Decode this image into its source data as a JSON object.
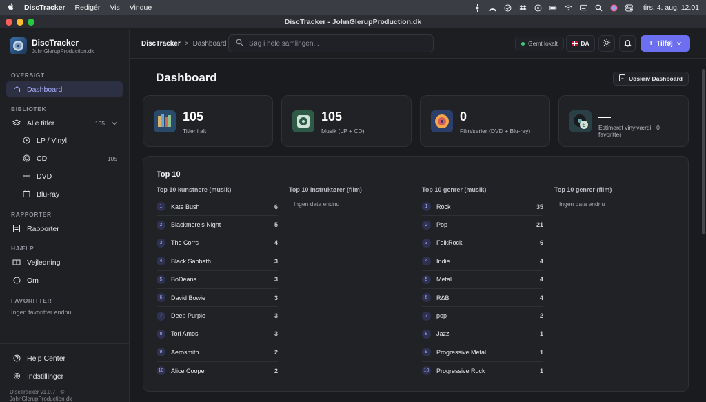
{
  "menubar": {
    "app": "DiscTracker",
    "items": [
      "Redigér",
      "Vis",
      "Vindue"
    ],
    "clock": "tirs. 4. aug.  12.01"
  },
  "window": {
    "title": "DiscTracker - JohnGlerupProduction.dk"
  },
  "brand": {
    "name": "DiscTracker",
    "sub": "JohnGlerupProduction.dk"
  },
  "sidebar": {
    "sections": {
      "oversigt": "OVERSIGT",
      "bibliotek": "BIBLIOTEK",
      "rapporter": "RAPPORTER",
      "hjaelp": "HJÆLP",
      "favoritter": "FAVORITTER"
    },
    "dashboard": "Dashboard",
    "all_titles": {
      "label": "Alle titler",
      "count": "105"
    },
    "lp": "LP / Vinyl",
    "cd": {
      "label": "CD",
      "count": "105"
    },
    "dvd": "DVD",
    "bluray": "Blu-ray",
    "reports": "Rapporter",
    "guide": "Vejledning",
    "about": "Om",
    "favorites_empty": "Ingen favoritter endnu",
    "help_center": "Help Center",
    "settings": "Indstillinger",
    "footer_line1": "DiscTracker v1.0.7 · ©",
    "footer_line2": "JohnGlerupProduction.dk"
  },
  "topbar": {
    "crumb_root": "DiscTracker",
    "crumb_sep": ">",
    "crumb_current": "Dashboard",
    "search_placeholder": "Søg i hele samlingen...",
    "saved": "Gemt lokalt",
    "lang": "DA",
    "add": "Tilføj"
  },
  "main": {
    "title": "Dashboard",
    "print": "Udskriv Dashboard",
    "cards": [
      {
        "value": "105",
        "label": "Titler i alt"
      },
      {
        "value": "105",
        "label": "Musik (LP + CD)"
      },
      {
        "value": "0",
        "label": "Film/serier (DVD + Blu-ray)"
      },
      {
        "value": "—",
        "label": "Estimeret vinylværdi · 0 favoritter"
      }
    ],
    "top10": {
      "title": "Top 10",
      "artists_title": "Top 10 kunstnere (musik)",
      "directors_title": "Top 10 instruktører (film)",
      "music_genres_title": "Top 10 genrer (musik)",
      "film_genres_title": "Top 10 genrer (film)",
      "empty": "Ingen data endnu",
      "artists": [
        {
          "rank": "1",
          "name": "Kate Bush",
          "count": "6"
        },
        {
          "rank": "2",
          "name": "Blackmore's Night",
          "count": "5"
        },
        {
          "rank": "3",
          "name": "The Corrs",
          "count": "4"
        },
        {
          "rank": "4",
          "name": "Black Sabbath",
          "count": "3"
        },
        {
          "rank": "5",
          "name": "BoDeans",
          "count": "3"
        },
        {
          "rank": "6",
          "name": "David Bowie",
          "count": "3"
        },
        {
          "rank": "7",
          "name": "Deep Purple",
          "count": "3"
        },
        {
          "rank": "8",
          "name": "Tori Amos",
          "count": "3"
        },
        {
          "rank": "9",
          "name": "Aerosmith",
          "count": "2"
        },
        {
          "rank": "10",
          "name": "Alice Cooper",
          "count": "2"
        }
      ],
      "genres": [
        {
          "rank": "1",
          "name": "Rock",
          "count": "35"
        },
        {
          "rank": "2",
          "name": "Pop",
          "count": "21"
        },
        {
          "rank": "3",
          "name": "FolkRock",
          "count": "6"
        },
        {
          "rank": "4",
          "name": "Indie",
          "count": "4"
        },
        {
          "rank": "5",
          "name": "Metal",
          "count": "4"
        },
        {
          "rank": "6",
          "name": "R&B",
          "count": "4"
        },
        {
          "rank": "7",
          "name": "pop",
          "count": "2"
        },
        {
          "rank": "8",
          "name": "Jazz",
          "count": "1"
        },
        {
          "rank": "9",
          "name": "Progressive Metal",
          "count": "1"
        },
        {
          "rank": "10",
          "name": "Progressive Rock",
          "count": "1"
        }
      ]
    }
  },
  "colors": {
    "accent": "#6b6ff0",
    "active_bg": "#2d3042",
    "saved_dot": "#3fcf7a"
  }
}
